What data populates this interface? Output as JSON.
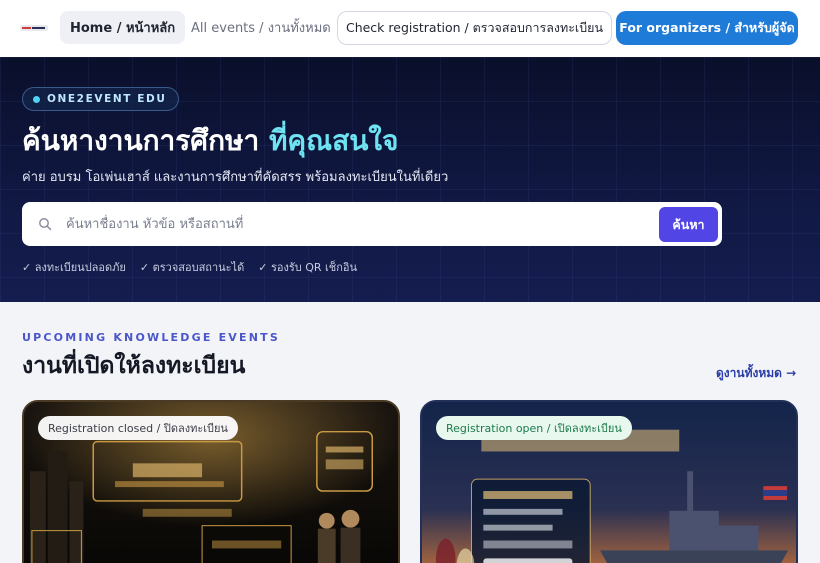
{
  "nav": {
    "home": "Home / หน้าหลัก",
    "all_events": "All events / งานทั้งหมด",
    "check_registration": "Check registration / ตรวจสอบการลงทะเบียน",
    "for_organizers": "For organizers / สำหรับผู้จัด"
  },
  "hero": {
    "badge": "ONE2EVENT EDU",
    "title_main": "ค้นหางานการศึกษา",
    "title_accent": "ที่คุณสนใจ",
    "subtitle": "ค่าย อบรม โอเพ่นเฮาส์ และงานการศึกษาที่คัดสรร พร้อมลงทะเบียนในที่เดียว",
    "search_placeholder": "ค้นหาชื่องาน หัวข้อ หรือสถานที่",
    "search_button": "ค้นหา",
    "features": [
      "✓ ลงทะเบียนปลอดภัย",
      "✓ ตรวจสอบสถานะได้",
      "✓ รองรับ QR เช็กอิน"
    ]
  },
  "section": {
    "kicker": "UPCOMING KNOWLEDGE EVENTS",
    "title": "งานที่เปิดให้ลงทะเบียน",
    "view_all": "ดูงานทั้งหมด →"
  },
  "events": [
    {
      "status": "Registration closed / ปิดลงทะเบียน"
    },
    {
      "status": "Registration open / เปิดลงทะเบียน"
    }
  ],
  "colors": {
    "accent_primary": "#1e7bd8",
    "search_button": "#5145e6",
    "hero_bg": "#0f1640",
    "title_accent": "#6fe3f2",
    "kicker": "#4b56c9"
  },
  "icons": {
    "search": "search-icon",
    "logo": "one2event-logo"
  }
}
